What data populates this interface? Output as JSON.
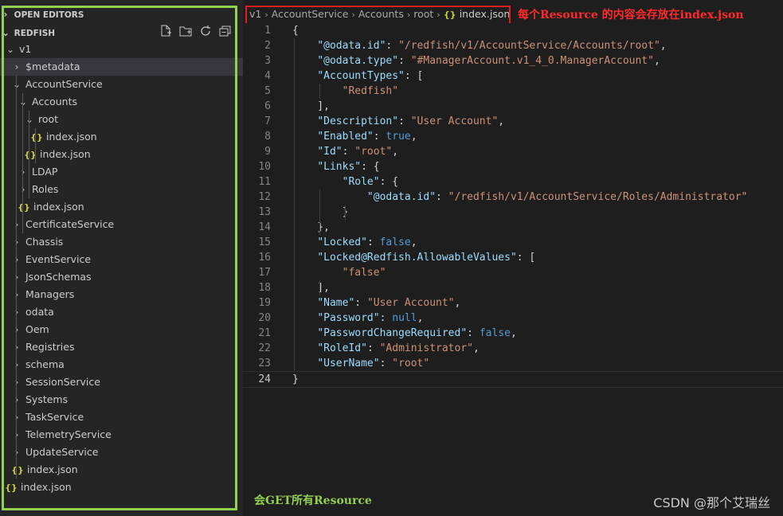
{
  "sidebar": {
    "open_editors_label": "OPEN EDITORS",
    "root_label": "REDFISH",
    "tree": [
      {
        "label": "v1",
        "type": "folder",
        "expanded": true
      },
      {
        "label": "$metadata",
        "type": "folder",
        "expanded": false
      },
      {
        "label": "AccountService",
        "type": "folder",
        "expanded": true
      },
      {
        "label": "Accounts",
        "type": "folder",
        "expanded": true
      },
      {
        "label": "root",
        "type": "folder",
        "expanded": true
      },
      {
        "label": "index.json",
        "type": "file"
      },
      {
        "label": "index.json",
        "type": "file"
      },
      {
        "label": "LDAP",
        "type": "folder",
        "expanded": false
      },
      {
        "label": "Roles",
        "type": "folder",
        "expanded": false
      },
      {
        "label": "index.json",
        "type": "file"
      },
      {
        "label": "CertificateService",
        "type": "folder",
        "expanded": false
      },
      {
        "label": "Chassis",
        "type": "folder",
        "expanded": false
      },
      {
        "label": "EventService",
        "type": "folder",
        "expanded": false
      },
      {
        "label": "JsonSchemas",
        "type": "folder",
        "expanded": false
      },
      {
        "label": "Managers",
        "type": "folder",
        "expanded": false
      },
      {
        "label": "odata",
        "type": "folder",
        "expanded": false
      },
      {
        "label": "Oem",
        "type": "folder",
        "expanded": false
      },
      {
        "label": "Registries",
        "type": "folder",
        "expanded": false
      },
      {
        "label": "schema",
        "type": "folder",
        "expanded": false
      },
      {
        "label": "SessionService",
        "type": "folder",
        "expanded": false
      },
      {
        "label": "Systems",
        "type": "folder",
        "expanded": false
      },
      {
        "label": "TaskService",
        "type": "folder",
        "expanded": false
      },
      {
        "label": "TelemetryService",
        "type": "folder",
        "expanded": false
      },
      {
        "label": "UpdateService",
        "type": "folder",
        "expanded": false
      },
      {
        "label": "index.json",
        "type": "file"
      },
      {
        "label": "index.json",
        "type": "file"
      }
    ],
    "json_icon_glyph": "{}",
    "header_actions": [
      "new-file-icon",
      "new-folder-icon",
      "refresh-icon",
      "collapse-all-icon"
    ]
  },
  "breadcrumb": {
    "items": [
      "v1",
      "AccountService",
      "Accounts",
      "root"
    ],
    "file_icon": "{}",
    "file": "index.json"
  },
  "annotations": {
    "red_note": "每个Resource 的内容会存放在index.json",
    "green_note": "会GET所有Resource",
    "red_color": "#e02020",
    "green_color": "#92d050"
  },
  "watermark": "CSDN @那个艾瑞丝",
  "editor": {
    "current_line": 24,
    "lines": [
      {
        "n": "1",
        "tokens": [
          [
            "p",
            "{"
          ]
        ]
      },
      {
        "n": "2",
        "tokens": [
          [
            "p",
            "    "
          ],
          [
            "k",
            "\"@odata.id\""
          ],
          [
            "p",
            ": "
          ],
          [
            "s",
            "\"/redfish/v1/AccountService/Accounts/root\""
          ],
          [
            "p",
            ","
          ]
        ]
      },
      {
        "n": "3",
        "tokens": [
          [
            "p",
            "    "
          ],
          [
            "k",
            "\"@odata.type\""
          ],
          [
            "p",
            ": "
          ],
          [
            "s",
            "\"#ManagerAccount.v1_4_0.ManagerAccount\""
          ],
          [
            "p",
            ","
          ]
        ]
      },
      {
        "n": "4",
        "tokens": [
          [
            "p",
            "    "
          ],
          [
            "k",
            "\"AccountTypes\""
          ],
          [
            "p",
            ": ["
          ]
        ]
      },
      {
        "n": "5",
        "tokens": [
          [
            "p",
            "        "
          ],
          [
            "s",
            "\"Redfish\""
          ]
        ]
      },
      {
        "n": "6",
        "tokens": [
          [
            "p",
            "    ],"
          ]
        ]
      },
      {
        "n": "7",
        "tokens": [
          [
            "p",
            "    "
          ],
          [
            "k",
            "\"Description\""
          ],
          [
            "p",
            ": "
          ],
          [
            "s",
            "\"User Account\""
          ],
          [
            "p",
            ","
          ]
        ]
      },
      {
        "n": "8",
        "tokens": [
          [
            "p",
            "    "
          ],
          [
            "k",
            "\"Enabled\""
          ],
          [
            "p",
            ": "
          ],
          [
            "b",
            "true"
          ],
          [
            "p",
            ","
          ]
        ]
      },
      {
        "n": "9",
        "tokens": [
          [
            "p",
            "    "
          ],
          [
            "k",
            "\"Id\""
          ],
          [
            "p",
            ": "
          ],
          [
            "s",
            "\"root\""
          ],
          [
            "p",
            ","
          ]
        ]
      },
      {
        "n": "10",
        "tokens": [
          [
            "p",
            "    "
          ],
          [
            "k",
            "\"Links\""
          ],
          [
            "p",
            ": {"
          ]
        ]
      },
      {
        "n": "11",
        "tokens": [
          [
            "p",
            "        "
          ],
          [
            "k",
            "\"Role\""
          ],
          [
            "p",
            ": {"
          ]
        ]
      },
      {
        "n": "12",
        "tokens": [
          [
            "p",
            "            "
          ],
          [
            "k",
            "\"@odata.id\""
          ],
          [
            "p",
            ": "
          ],
          [
            "s",
            "\"/redfish/v1/AccountService/Roles/Administrator\""
          ]
        ]
      },
      {
        "n": "13",
        "tokens": [
          [
            "p",
            "        }"
          ]
        ]
      },
      {
        "n": "14",
        "tokens": [
          [
            "p",
            "    },"
          ]
        ]
      },
      {
        "n": "15",
        "tokens": [
          [
            "p",
            "    "
          ],
          [
            "k",
            "\"Locked\""
          ],
          [
            "p",
            ": "
          ],
          [
            "b",
            "false"
          ],
          [
            "p",
            ","
          ]
        ]
      },
      {
        "n": "16",
        "tokens": [
          [
            "p",
            "    "
          ],
          [
            "k",
            "\"Locked@Redfish.AllowableValues\""
          ],
          [
            "p",
            ": ["
          ]
        ]
      },
      {
        "n": "17",
        "tokens": [
          [
            "p",
            "        "
          ],
          [
            "s",
            "\"false\""
          ]
        ]
      },
      {
        "n": "18",
        "tokens": [
          [
            "p",
            "    ],"
          ]
        ]
      },
      {
        "n": "19",
        "tokens": [
          [
            "p",
            "    "
          ],
          [
            "k",
            "\"Name\""
          ],
          [
            "p",
            ": "
          ],
          [
            "s",
            "\"User Account\""
          ],
          [
            "p",
            ","
          ]
        ]
      },
      {
        "n": "20",
        "tokens": [
          [
            "p",
            "    "
          ],
          [
            "k",
            "\"Password\""
          ],
          [
            "p",
            ": "
          ],
          [
            "b",
            "null"
          ],
          [
            "p",
            ","
          ]
        ]
      },
      {
        "n": "21",
        "tokens": [
          [
            "p",
            "    "
          ],
          [
            "k",
            "\"PasswordChangeRequired\""
          ],
          [
            "p",
            ": "
          ],
          [
            "b",
            "false"
          ],
          [
            "p",
            ","
          ]
        ]
      },
      {
        "n": "22",
        "tokens": [
          [
            "p",
            "    "
          ],
          [
            "k",
            "\"RoleId\""
          ],
          [
            "p",
            ": "
          ],
          [
            "s",
            "\"Administrator\""
          ],
          [
            "p",
            ","
          ]
        ]
      },
      {
        "n": "23",
        "tokens": [
          [
            "p",
            "    "
          ],
          [
            "k",
            "\"UserName\""
          ],
          [
            "p",
            ": "
          ],
          [
            "s",
            "\"root\""
          ]
        ]
      },
      {
        "n": "24",
        "tokens": [
          [
            "p",
            "}"
          ]
        ]
      }
    ]
  }
}
